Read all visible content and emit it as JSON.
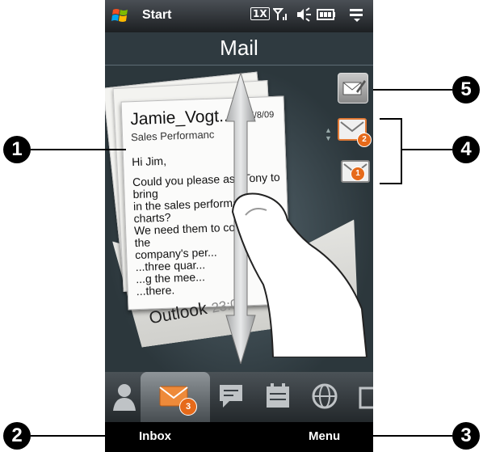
{
  "status_bar": {
    "start_label": "Start",
    "icons": [
      "windows-logo-icon",
      "1x-network-icon",
      "signal-icon",
      "volume-icon",
      "battery-icon",
      "menu-icon"
    ],
    "network_badge": "1X"
  },
  "app": {
    "title": "Mail"
  },
  "message": {
    "sender": "Jamie_Vogt...",
    "date": "5/8/09",
    "subject": "Sales Performanc",
    "greeting": "Hi Jim,",
    "body": "Could you please ask Tony to bring\nin the sales performance charts?\nWe need them to complete the\ncompany's per...\n...three quar...\n...g the mee...\n...there.",
    "account": "Outlook",
    "timestamp": "23:09"
  },
  "side_controls": {
    "compose_icon": "compose-mail-icon",
    "threads": [
      {
        "badge": "2",
        "icon": "envelope-icon"
      },
      {
        "badge": "1",
        "icon": "envelope-icon"
      }
    ]
  },
  "tabs": [
    {
      "name": "people",
      "icon": "person-icon"
    },
    {
      "name": "mail",
      "icon": "envelope-icon",
      "badge": "3",
      "active": true
    },
    {
      "name": "messages",
      "icon": "chat-bubble-icon"
    },
    {
      "name": "calendar",
      "icon": "calendar-icon"
    },
    {
      "name": "internet",
      "icon": "globe-icon"
    }
  ],
  "softkeys": {
    "left": "Inbox",
    "right": "Menu"
  },
  "callouts": [
    "1",
    "2",
    "3",
    "4",
    "5"
  ],
  "colors": {
    "badge": "#e66a1a",
    "screen_bg": "#2f3a40"
  }
}
